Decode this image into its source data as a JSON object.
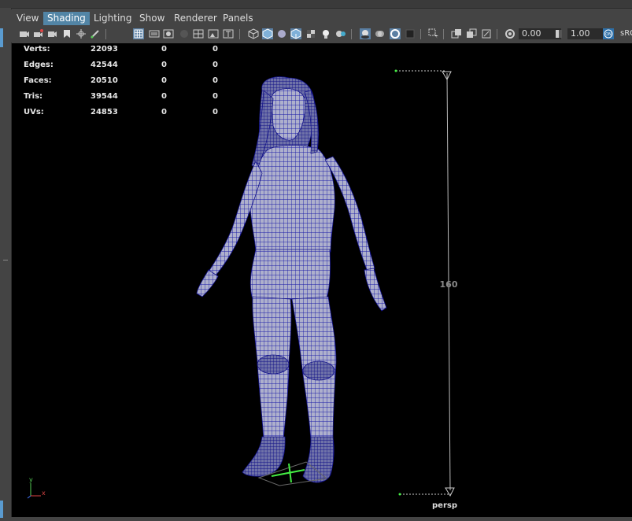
{
  "menu": {
    "items": [
      {
        "label": "View",
        "active": false
      },
      {
        "label": "Shading",
        "active": true
      },
      {
        "label": "Lighting",
        "active": false
      },
      {
        "label": "Show",
        "active": false
      },
      {
        "label": "Renderer",
        "active": false
      },
      {
        "label": "Panels",
        "active": false
      }
    ]
  },
  "toolbar": {
    "exposure_value": "0.00",
    "gamma_value": "1.00",
    "color_space_label": "sRG"
  },
  "hud": {
    "rows": [
      {
        "label": "Verts:",
        "v1": "22093",
        "v2": "0",
        "v3": "0"
      },
      {
        "label": "Edges:",
        "v1": "42544",
        "v2": "0",
        "v3": "0"
      },
      {
        "label": "Faces:",
        "v1": "20510",
        "v2": "0",
        "v3": "0"
      },
      {
        "label": "Tris:",
        "v1": "39544",
        "v2": "0",
        "v3": "0"
      },
      {
        "label": "UVs:",
        "v1": "24853",
        "v2": "0",
        "v3": "0"
      }
    ]
  },
  "viewport": {
    "camera_label": "persp",
    "measure_value": "160",
    "axis_x": "x",
    "axis_y": "y",
    "wire_color": "#1c1ca8",
    "mesh_color": "#b9b9d2",
    "background": "#000000",
    "grid_color": "#44ee44",
    "accent_color": "#5285a6"
  }
}
